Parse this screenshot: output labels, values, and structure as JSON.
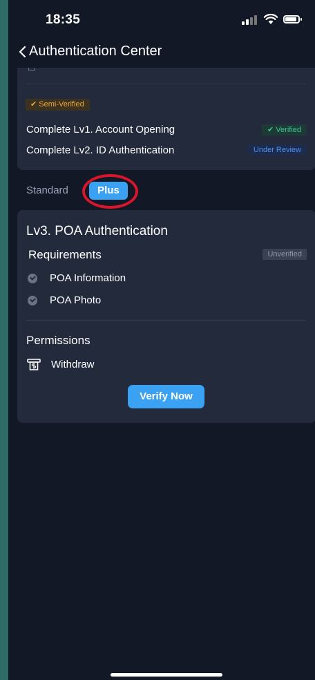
{
  "status_bar": {
    "time": "18:35"
  },
  "header": {
    "title": "Authentication Center"
  },
  "level_summary": {
    "badge": "✔ Semi-Verified",
    "rows": [
      {
        "label": "Complete Lv1. Account Opening",
        "status": "✔ Verified"
      },
      {
        "label": "Complete Lv2. ID Authentication",
        "status": "Under Review"
      }
    ]
  },
  "tabs": {
    "standard": "Standard",
    "plus": "Plus",
    "selected": "Plus"
  },
  "lv3": {
    "title": "Lv3. POA Authentication",
    "requirements_heading": "Requirements",
    "status": "Unverified",
    "requirements": [
      "POA Information",
      "POA Photo"
    ],
    "permissions_heading": "Permissions",
    "permission": "Withdraw",
    "action": "Verify Now"
  },
  "colors": {
    "accent": "#3ba1f3",
    "verified": "#3ec79a",
    "semi_verified": "#e9a63c",
    "under_review": "#4c8ff0",
    "highlight": "#d9162a"
  }
}
